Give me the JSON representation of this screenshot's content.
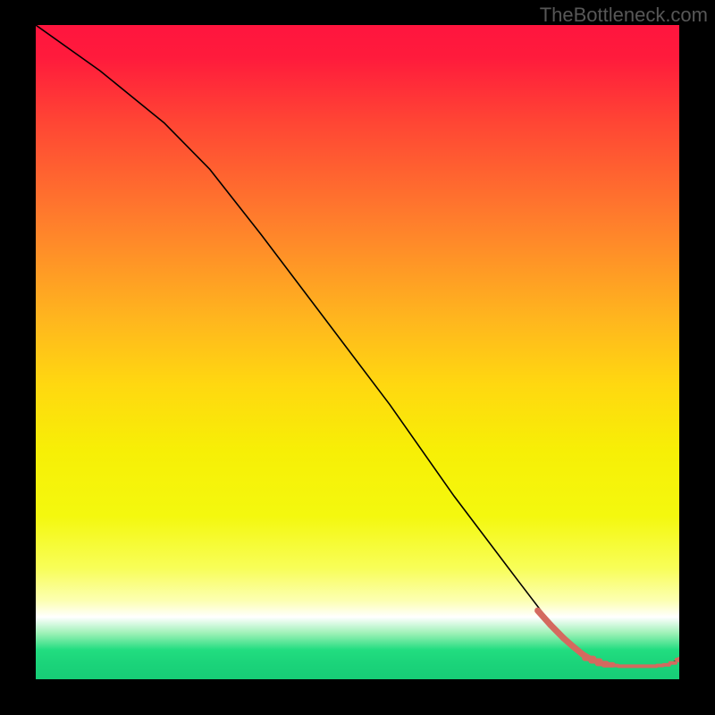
{
  "watermark": "TheBottleneck.com",
  "chart_data": {
    "type": "line",
    "title": "",
    "xlabel": "",
    "ylabel": "",
    "xlim": [
      0,
      100
    ],
    "ylim": [
      0,
      100
    ],
    "gradient_stops": [
      {
        "offset": 0.0,
        "color": "#ff153e"
      },
      {
        "offset": 0.05,
        "color": "#ff1b3c"
      },
      {
        "offset": 0.15,
        "color": "#ff4634"
      },
      {
        "offset": 0.3,
        "color": "#ff7e2c"
      },
      {
        "offset": 0.45,
        "color": "#ffb61e"
      },
      {
        "offset": 0.55,
        "color": "#ffd810"
      },
      {
        "offset": 0.65,
        "color": "#f7ef06"
      },
      {
        "offset": 0.75,
        "color": "#f4f80e"
      },
      {
        "offset": 0.83,
        "color": "#f8fe58"
      },
      {
        "offset": 0.88,
        "color": "#fcffb2"
      },
      {
        "offset": 0.905,
        "color": "#ffffff"
      },
      {
        "offset": 0.93,
        "color": "#9cf1b6"
      },
      {
        "offset": 0.955,
        "color": "#22dd80"
      },
      {
        "offset": 0.975,
        "color": "#1bd47a"
      },
      {
        "offset": 1.0,
        "color": "#17cd76"
      }
    ],
    "series": [
      {
        "name": "main-curve",
        "x": [
          0,
          10,
          20,
          27,
          35,
          45,
          55,
          65,
          75,
          82,
          85,
          88,
          91,
          94,
          96,
          98,
          100
        ],
        "y": [
          100,
          93,
          85,
          78,
          68,
          55,
          42,
          28,
          15,
          6,
          3.5,
          2.3,
          2.0,
          2.0,
          2.0,
          2.2,
          3.0
        ]
      }
    ],
    "marker_band": {
      "name": "dash-overlay",
      "color": "#d46a5f",
      "x": [
        78,
        80,
        82,
        83.5,
        85,
        86,
        87,
        88,
        89,
        90,
        91,
        92,
        93,
        94,
        95,
        96,
        97,
        98,
        99,
        100
      ],
      "y": [
        10.5,
        8.3,
        6.3,
        5.0,
        3.8,
        3.2,
        2.8,
        2.4,
        2.2,
        2.1,
        2.0,
        2.0,
        2.0,
        2.0,
        2.0,
        2.0,
        2.1,
        2.2,
        2.5,
        3.0
      ]
    }
  }
}
